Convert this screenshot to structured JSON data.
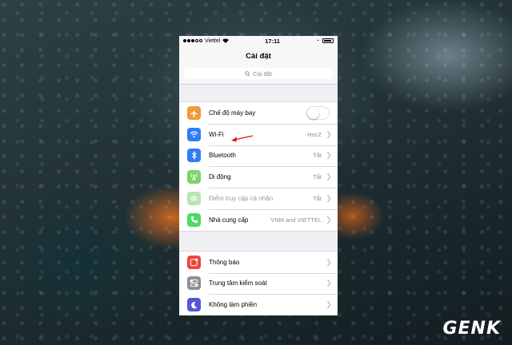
{
  "status_bar": {
    "carrier": "Viettel",
    "time": "17:11"
  },
  "nav": {
    "title": "Cài đặt"
  },
  "search": {
    "placeholder": "Cài đặt"
  },
  "group1": [
    {
      "label": "Chế độ máy bay",
      "value": "",
      "icon": "airplane-icon",
      "color": "#f19a38",
      "control": "toggle",
      "toggle_on": false
    },
    {
      "label": "Wi-Fi",
      "value": "HocZ",
      "icon": "wifi-icon",
      "color": "#2f7cf6"
    },
    {
      "label": "Bluetooth",
      "value": "Tắt",
      "icon": "bluetooth-icon",
      "color": "#2f7cf6"
    },
    {
      "label": "Di động",
      "value": "Tắt",
      "icon": "cellular-icon",
      "color": "#7ed36b",
      "dim": false
    },
    {
      "label": "Điểm truy cập cá nhân",
      "value": "Tắt",
      "icon": "hotspot-icon",
      "color": "#b8e6b0",
      "dim": true
    },
    {
      "label": "Nhà cung cấp",
      "value": "VNM and VIETTEL",
      "icon": "phone-icon",
      "color": "#4cd964"
    }
  ],
  "group2": [
    {
      "label": "Thông báo",
      "value": "",
      "icon": "notifications-icon",
      "color": "#f0433a"
    },
    {
      "label": "Trung tâm kiểm soát",
      "value": "",
      "icon": "control-center-icon",
      "color": "#8e8e93"
    },
    {
      "label": "Không làm phiền",
      "value": "",
      "icon": "moon-icon",
      "color": "#5856d6"
    }
  ],
  "annotation": {
    "arrow_color": "#e0141e"
  },
  "watermark": {
    "text": "GENK"
  }
}
